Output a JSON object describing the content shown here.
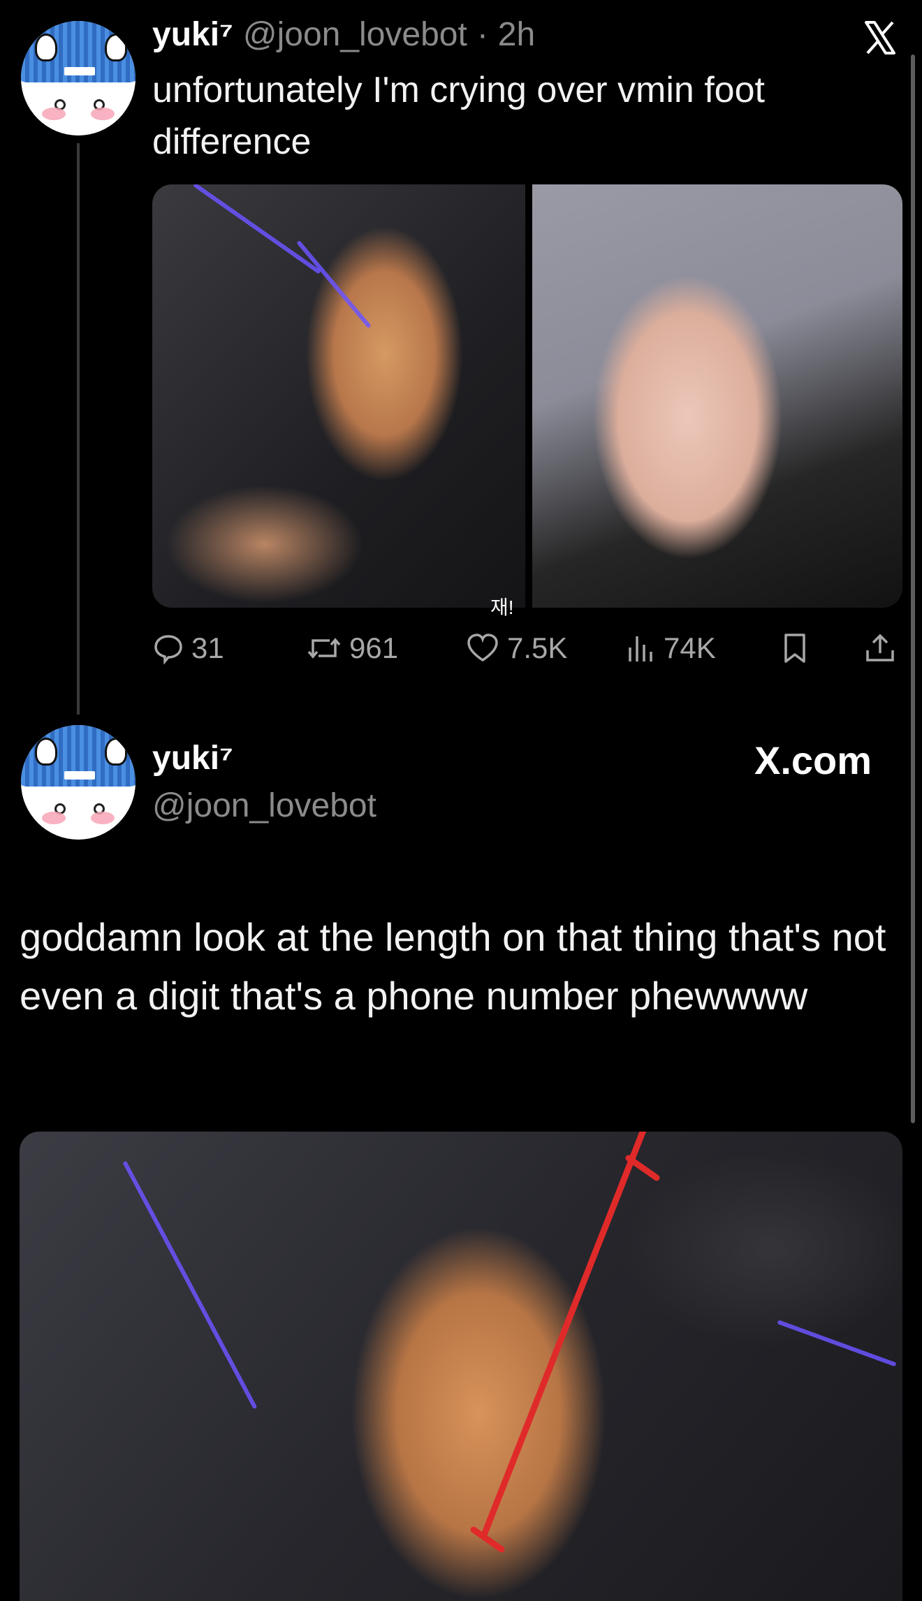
{
  "colors": {
    "background": "#000000",
    "text": "#ffffff",
    "muted": "#8b8b8b",
    "icon": "#a8a8a8",
    "annotation_line": "#e02a2a"
  },
  "quoted_tweet": {
    "display_name": "yuki⁷",
    "handle": "@joon_lovebot",
    "separator": "·",
    "time": "2h",
    "close_icon": "x-logo-icon",
    "text": "unfortunately I'm crying over vmin foot difference",
    "media_overlay_text": "재!",
    "actions": {
      "replies": "31",
      "retweets": "961",
      "likes": "7.5K",
      "views": "74K",
      "icons": [
        "reply-icon",
        "retweet-icon",
        "like-icon",
        "views-icon",
        "bookmark-icon",
        "share-icon"
      ]
    }
  },
  "reply_tweet": {
    "display_name": "yuki⁷",
    "handle": "@joon_lovebot",
    "source": "X.com",
    "text": "goddamn look at the length on that thing that's not even a digit that's a phone number phewwww"
  }
}
